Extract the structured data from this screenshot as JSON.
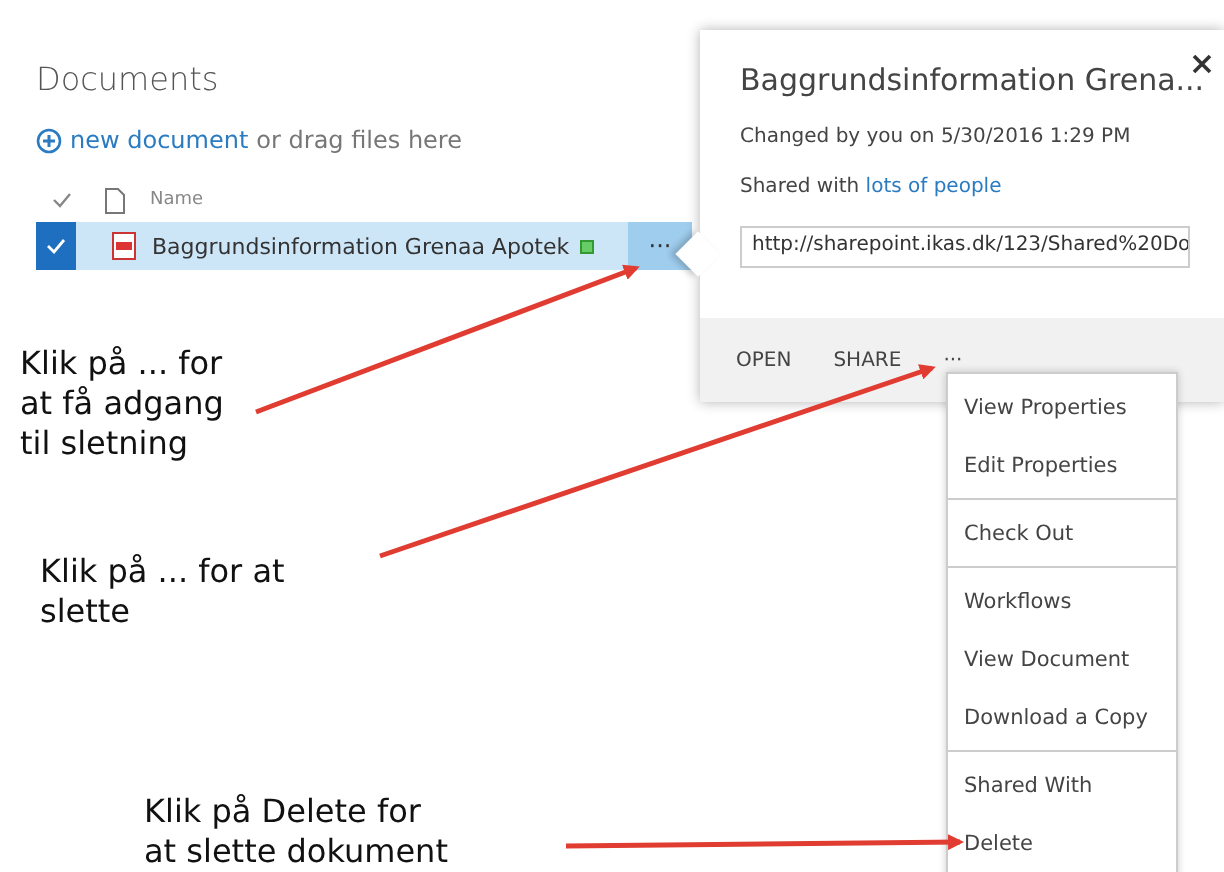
{
  "library": {
    "title": "Documents",
    "new_document": {
      "link": "new document",
      "text": "or drag files here"
    },
    "columns": [
      {
        "label": "Name"
      }
    ],
    "rows": [
      {
        "name": "Baggrundsinformation Grenaa Apotek",
        "selected": true,
        "more": "···"
      }
    ]
  },
  "callout": {
    "title": "Baggrundsinformation Grena...",
    "changed": "Changed by you on 5/30/2016 1:29 PM",
    "shared_prefix": "Shared with",
    "shared_link": "lots of people",
    "url": "http://sharepoint.ikas.dk/123/Shared%20Do",
    "actions": [
      "OPEN",
      "SHARE",
      "···"
    ]
  },
  "menu": {
    "groups": [
      {
        "items": [
          "View Properties",
          "Edit Properties"
        ]
      },
      {
        "items": [
          "Check Out"
        ]
      },
      {
        "items": [
          "Workflows",
          "View Document",
          "Download a Copy"
        ]
      },
      {
        "items": [
          "Shared With",
          "Delete"
        ]
      }
    ]
  },
  "annotations": [
    {
      "text": "Klik på ... for\nat få adgang\ntil sletning"
    },
    {
      "text": "Klik på ... for at\nslette"
    },
    {
      "text": "Klik på Delete for\nat slette dokument"
    }
  ]
}
